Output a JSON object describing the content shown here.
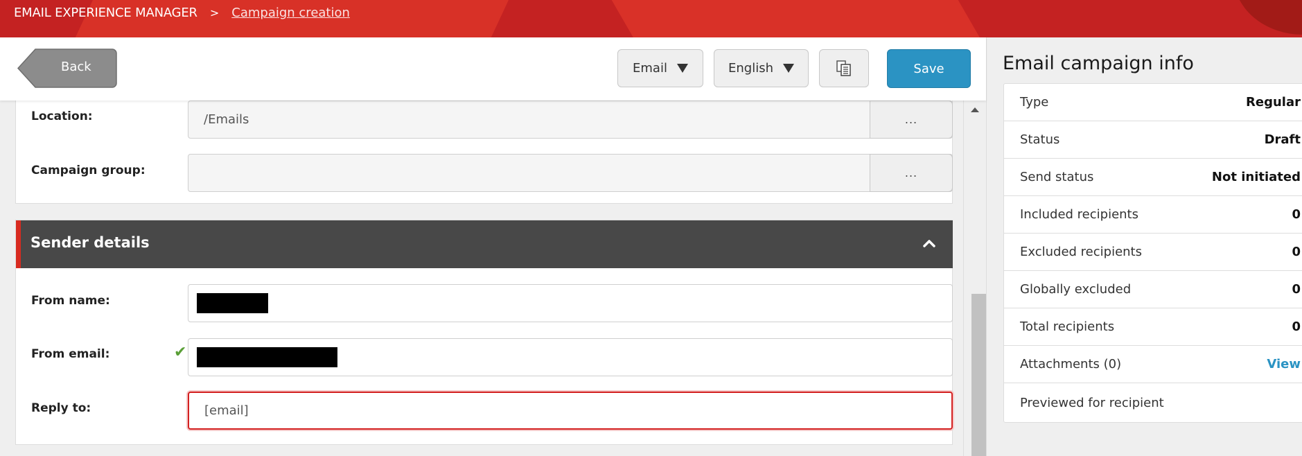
{
  "header": {
    "app_name": "EMAIL EXPERIENCE MANAGER",
    "separator": ">",
    "breadcrumb_current": "Campaign creation"
  },
  "toolbar": {
    "back_label": "Back",
    "type_dropdown": "Email",
    "language_dropdown": "English",
    "copy_icon": "copy-icon",
    "save_label": "Save"
  },
  "general": {
    "location_label": "Location:",
    "location_value": "/Emails",
    "campaign_group_label": "Campaign group:",
    "campaign_group_value": "",
    "browse_label": "..."
  },
  "sender": {
    "title": "Sender details",
    "from_name_label": "From name:",
    "from_email_label": "From email:",
    "from_email_valid": true,
    "reply_to_label": "Reply to:",
    "reply_to_value": "[email]",
    "reply_to_state": "error"
  },
  "info_panel": {
    "title": "Email campaign info",
    "rows": [
      {
        "label": "Type",
        "value": "Regular"
      },
      {
        "label": "Status",
        "value": "Draft"
      },
      {
        "label": "Send status",
        "value": "Not initiated"
      },
      {
        "label": "Included recipients",
        "value": "0"
      },
      {
        "label": "Excluded recipients",
        "value": "0"
      },
      {
        "label": "Globally excluded",
        "value": "0"
      },
      {
        "label": "Total recipients",
        "value": "0"
      },
      {
        "label": "Attachments (0)",
        "value": "View"
      },
      {
        "label": "Previewed for recipient",
        "value": ""
      }
    ]
  },
  "colors": {
    "brand_red": "#c42222",
    "primary_blue": "#2b93c3",
    "section_header": "#484848",
    "valid_green": "#5a9f37",
    "error_red": "#d32020"
  }
}
